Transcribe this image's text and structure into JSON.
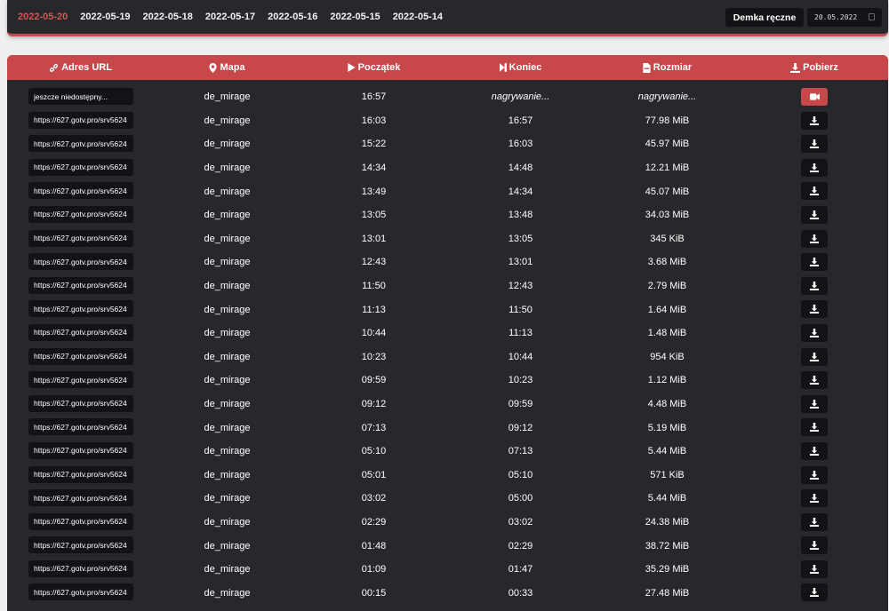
{
  "nav": {
    "dates": [
      {
        "label": "2022-05-20",
        "active": true
      },
      {
        "label": "2022-05-19",
        "active": false
      },
      {
        "label": "2022-05-18",
        "active": false
      },
      {
        "label": "2022-05-17",
        "active": false
      },
      {
        "label": "2022-05-16",
        "active": false
      },
      {
        "label": "2022-05-15",
        "active": false
      },
      {
        "label": "2022-05-14",
        "active": false
      }
    ],
    "manual_button_label": "Demka ręczne",
    "date_input_value": "20.05.2022"
  },
  "table": {
    "headers": {
      "url": "Adres URL",
      "map": "Mapa",
      "start": "Początek",
      "end": "Koniec",
      "size": "Rozmiar",
      "download": "Pobierz"
    },
    "rows": [
      {
        "url": "jeszcze niedostępny...",
        "map": "de_mirage",
        "start": "16:57",
        "end": "nagrywanie...",
        "size": "nagrywanie...",
        "recording": true
      },
      {
        "url": "https://627.gotv.pro/srv5624",
        "map": "de_mirage",
        "start": "16:03",
        "end": "16:57",
        "size": "77.98 MiB",
        "recording": false
      },
      {
        "url": "https://627.gotv.pro/srv5624",
        "map": "de_mirage",
        "start": "15:22",
        "end": "16:03",
        "size": "45.97 MiB",
        "recording": false
      },
      {
        "url": "https://627.gotv.pro/srv5624",
        "map": "de_mirage",
        "start": "14:34",
        "end": "14:48",
        "size": "12.21 MiB",
        "recording": false
      },
      {
        "url": "https://627.gotv.pro/srv5624",
        "map": "de_mirage",
        "start": "13:49",
        "end": "14:34",
        "size": "45.07 MiB",
        "recording": false
      },
      {
        "url": "https://627.gotv.pro/srv5624",
        "map": "de_mirage",
        "start": "13:05",
        "end": "13:48",
        "size": "34.03 MiB",
        "recording": false
      },
      {
        "url": "https://627.gotv.pro/srv5624",
        "map": "de_mirage",
        "start": "13:01",
        "end": "13:05",
        "size": "345 KiB",
        "recording": false
      },
      {
        "url": "https://627.gotv.pro/srv5624",
        "map": "de_mirage",
        "start": "12:43",
        "end": "13:01",
        "size": "3.68 MiB",
        "recording": false
      },
      {
        "url": "https://627.gotv.pro/srv5624",
        "map": "de_mirage",
        "start": "11:50",
        "end": "12:43",
        "size": "2.79 MiB",
        "recording": false
      },
      {
        "url": "https://627.gotv.pro/srv5624",
        "map": "de_mirage",
        "start": "11:13",
        "end": "11:50",
        "size": "1.64 MiB",
        "recording": false
      },
      {
        "url": "https://627.gotv.pro/srv5624",
        "map": "de_mirage",
        "start": "10:44",
        "end": "11:13",
        "size": "1.48 MiB",
        "recording": false
      },
      {
        "url": "https://627.gotv.pro/srv5624",
        "map": "de_mirage",
        "start": "10:23",
        "end": "10:44",
        "size": "954 KiB",
        "recording": false
      },
      {
        "url": "https://627.gotv.pro/srv5624",
        "map": "de_mirage",
        "start": "09:59",
        "end": "10:23",
        "size": "1.12 MiB",
        "recording": false
      },
      {
        "url": "https://627.gotv.pro/srv5624",
        "map": "de_mirage",
        "start": "09:12",
        "end": "09:59",
        "size": "4.48 MiB",
        "recording": false
      },
      {
        "url": "https://627.gotv.pro/srv5624",
        "map": "de_mirage",
        "start": "07:13",
        "end": "09:12",
        "size": "5.19 MiB",
        "recording": false
      },
      {
        "url": "https://627.gotv.pro/srv5624",
        "map": "de_mirage",
        "start": "05:10",
        "end": "07:13",
        "size": "5.44 MiB",
        "recording": false
      },
      {
        "url": "https://627.gotv.pro/srv5624",
        "map": "de_mirage",
        "start": "05:01",
        "end": "05:10",
        "size": "571 KiB",
        "recording": false
      },
      {
        "url": "https://627.gotv.pro/srv5624",
        "map": "de_mirage",
        "start": "03:02",
        "end": "05:00",
        "size": "5.44 MiB",
        "recording": false
      },
      {
        "url": "https://627.gotv.pro/srv5624",
        "map": "de_mirage",
        "start": "02:29",
        "end": "03:02",
        "size": "24.38 MiB",
        "recording": false
      },
      {
        "url": "https://627.gotv.pro/srv5624",
        "map": "de_mirage",
        "start": "01:48",
        "end": "02:29",
        "size": "38.72 MiB",
        "recording": false
      },
      {
        "url": "https://627.gotv.pro/srv5624",
        "map": "de_mirage",
        "start": "01:09",
        "end": "01:47",
        "size": "35.29 MiB",
        "recording": false
      },
      {
        "url": "https://627.gotv.pro/srv5624",
        "map": "de_mirage",
        "start": "00:15",
        "end": "00:33",
        "size": "27.48 MiB",
        "recording": false
      }
    ]
  },
  "colors": {
    "accent": "#c8474a",
    "active_date": "#d9534f",
    "panel_bg": "#26282c",
    "input_bg": "#121316",
    "page_bg": "#efefef"
  }
}
